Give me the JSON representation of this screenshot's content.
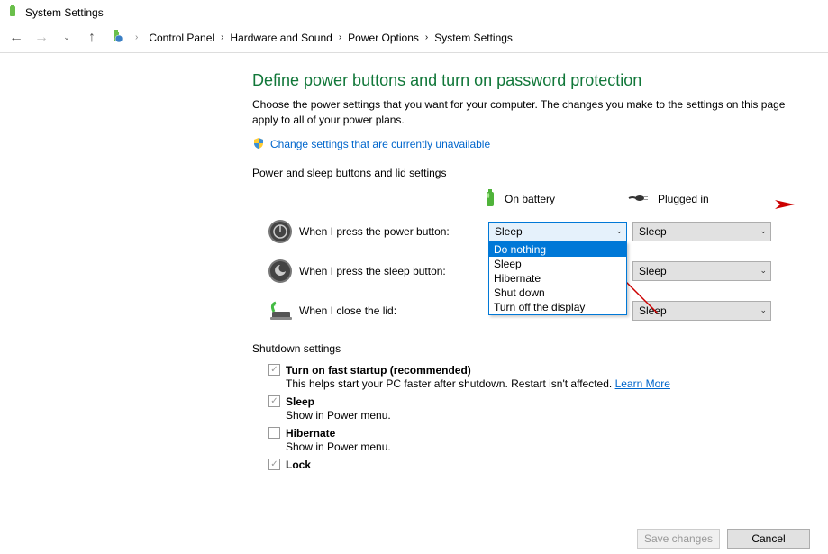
{
  "window": {
    "title": "System Settings"
  },
  "breadcrumb": {
    "items": [
      "Control Panel",
      "Hardware and Sound",
      "Power Options",
      "System Settings"
    ]
  },
  "page": {
    "title": "Define power buttons and turn on password protection",
    "subtitle": "Choose the power settings that you want for your computer. The changes you make to the settings on this page apply to all of your power plans.",
    "change_link": "Change settings that are currently unavailable"
  },
  "power_section": {
    "label": "Power and sleep buttons and lid settings",
    "col_battery": "On battery",
    "col_plugged": "Plugged in",
    "rows": [
      {
        "label": "When I press the power button:",
        "battery": "Sleep",
        "plugged": "Sleep"
      },
      {
        "label": "When I press the sleep button:",
        "battery": "",
        "plugged": "Sleep"
      },
      {
        "label": "When I close the lid:",
        "battery": "",
        "plugged": "Sleep"
      }
    ],
    "options": [
      "Do nothing",
      "Sleep",
      "Hibernate",
      "Shut down",
      "Turn off the display"
    ]
  },
  "shutdown": {
    "label": "Shutdown settings",
    "fast_startup": "Turn on fast startup (recommended)",
    "fast_help": "This helps start your PC faster after shutdown. Restart isn't affected. ",
    "learn_more": "Learn More",
    "sleep": "Sleep",
    "sleep_help": "Show in Power menu.",
    "hibernate": "Hibernate",
    "hibernate_help": "Show in Power menu.",
    "lock": "Lock"
  },
  "footer": {
    "save": "Save changes",
    "cancel": "Cancel"
  }
}
